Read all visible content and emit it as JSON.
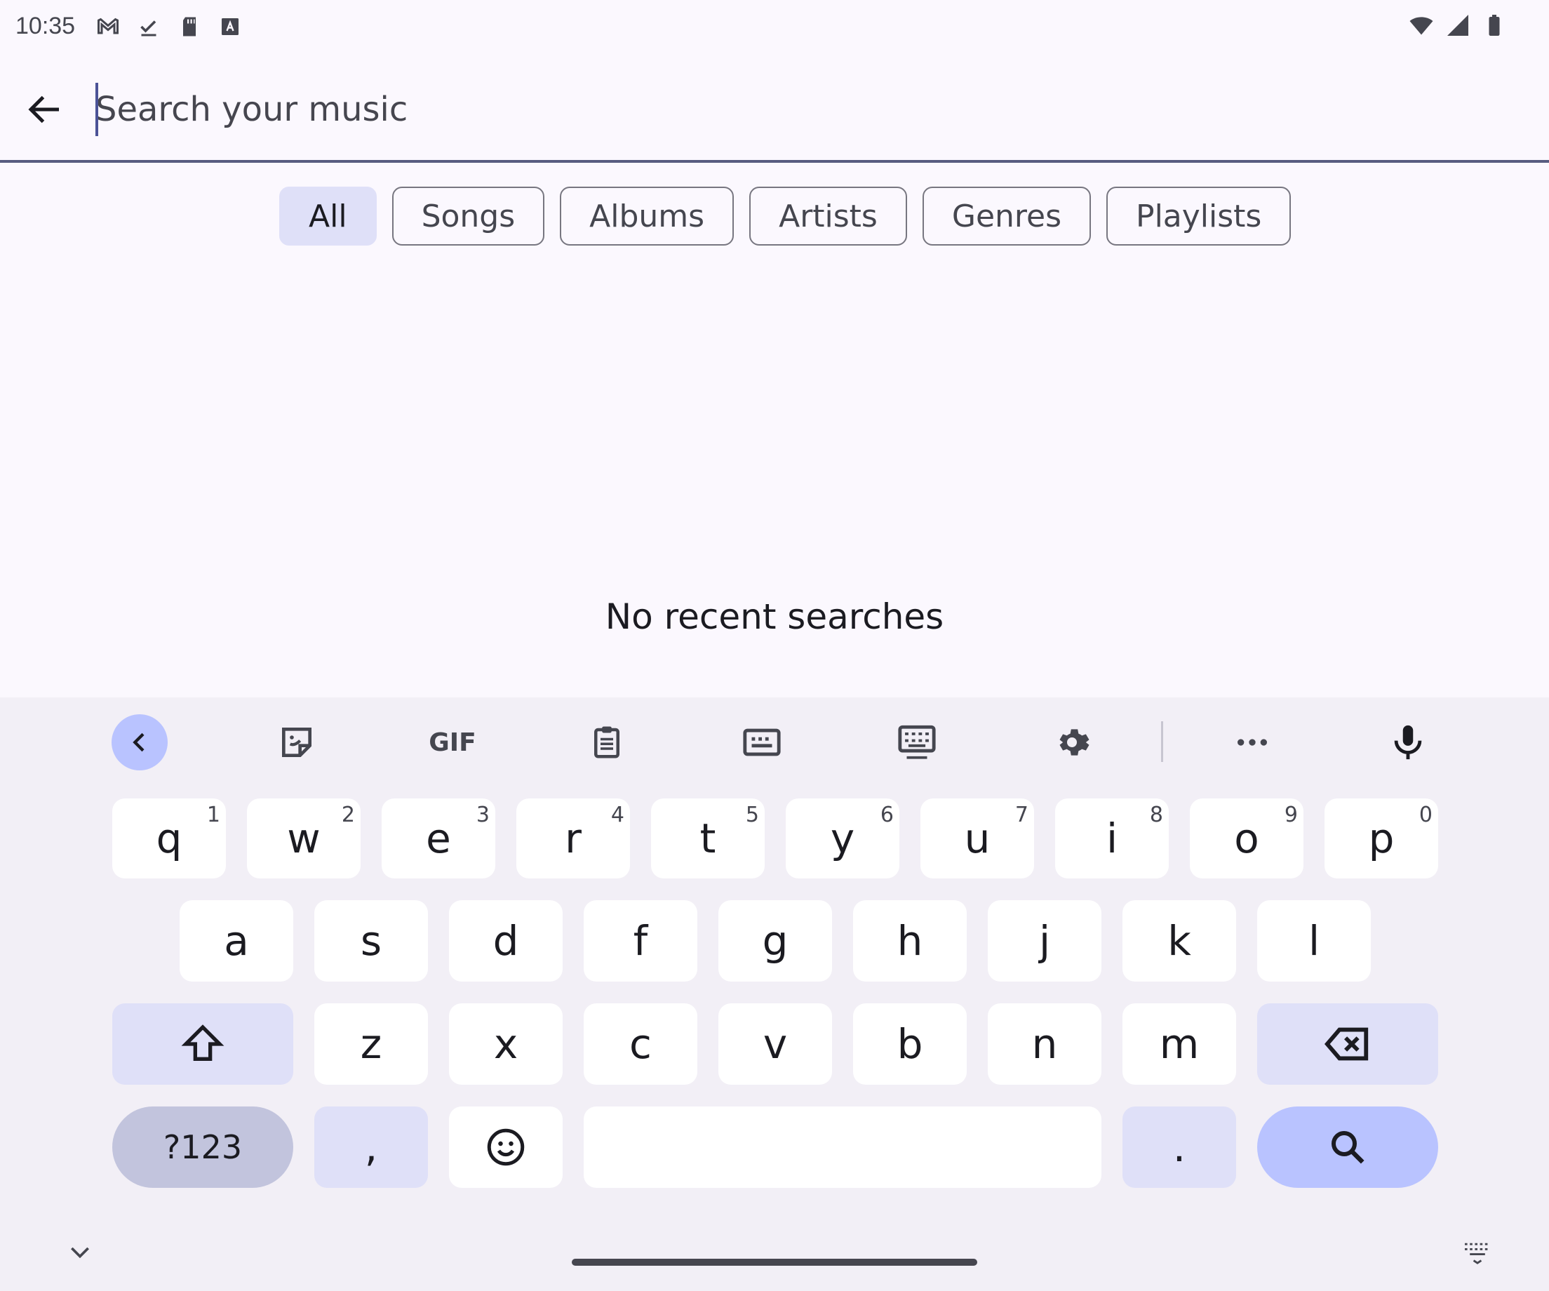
{
  "status_bar": {
    "time": "10:35",
    "left_icons": [
      "gmail-icon",
      "download-done-icon",
      "sd-card-icon",
      "keyboard-app-icon"
    ],
    "right_icons": [
      "wifi-icon",
      "signal-icon",
      "battery-icon"
    ]
  },
  "search": {
    "placeholder": "Search your music",
    "value": ""
  },
  "filters": [
    {
      "label": "All",
      "selected": true
    },
    {
      "label": "Songs",
      "selected": false
    },
    {
      "label": "Albums",
      "selected": false
    },
    {
      "label": "Artists",
      "selected": false
    },
    {
      "label": "Genres",
      "selected": false
    },
    {
      "label": "Playlists",
      "selected": false
    }
  ],
  "empty_state": "No recent searches",
  "keyboard": {
    "toolbar": {
      "gif_label": "GIF"
    },
    "row1": [
      {
        "key": "q",
        "hint": "1"
      },
      {
        "key": "w",
        "hint": "2"
      },
      {
        "key": "e",
        "hint": "3"
      },
      {
        "key": "r",
        "hint": "4"
      },
      {
        "key": "t",
        "hint": "5"
      },
      {
        "key": "y",
        "hint": "6"
      },
      {
        "key": "u",
        "hint": "7"
      },
      {
        "key": "i",
        "hint": "8"
      },
      {
        "key": "o",
        "hint": "9"
      },
      {
        "key": "p",
        "hint": "0"
      }
    ],
    "row2": [
      "a",
      "s",
      "d",
      "f",
      "g",
      "h",
      "j",
      "k",
      "l"
    ],
    "row3": [
      "z",
      "x",
      "c",
      "v",
      "b",
      "n",
      "m"
    ],
    "symbols_label": "?123",
    "comma": ",",
    "period": ".",
    "colors": {
      "accent": "#b9c3ff",
      "special_key": "#dfe0f8",
      "background": "#f2eff6"
    }
  }
}
